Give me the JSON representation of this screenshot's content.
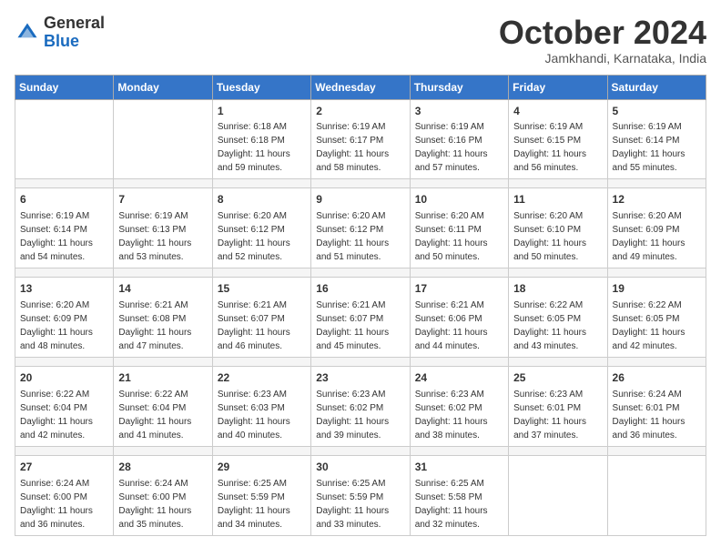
{
  "header": {
    "logo": {
      "general": "General",
      "blue": "Blue"
    },
    "month": "October 2024",
    "location": "Jamkhandi, Karnataka, India"
  },
  "weekdays": [
    "Sunday",
    "Monday",
    "Tuesday",
    "Wednesday",
    "Thursday",
    "Friday",
    "Saturday"
  ],
  "weeks": [
    [
      {
        "day": "",
        "sunrise": "",
        "sunset": "",
        "daylight": ""
      },
      {
        "day": "",
        "sunrise": "",
        "sunset": "",
        "daylight": ""
      },
      {
        "day": "1",
        "sunrise": "Sunrise: 6:18 AM",
        "sunset": "Sunset: 6:18 PM",
        "daylight": "Daylight: 11 hours and 59 minutes."
      },
      {
        "day": "2",
        "sunrise": "Sunrise: 6:19 AM",
        "sunset": "Sunset: 6:17 PM",
        "daylight": "Daylight: 11 hours and 58 minutes."
      },
      {
        "day": "3",
        "sunrise": "Sunrise: 6:19 AM",
        "sunset": "Sunset: 6:16 PM",
        "daylight": "Daylight: 11 hours and 57 minutes."
      },
      {
        "day": "4",
        "sunrise": "Sunrise: 6:19 AM",
        "sunset": "Sunset: 6:15 PM",
        "daylight": "Daylight: 11 hours and 56 minutes."
      },
      {
        "day": "5",
        "sunrise": "Sunrise: 6:19 AM",
        "sunset": "Sunset: 6:14 PM",
        "daylight": "Daylight: 11 hours and 55 minutes."
      }
    ],
    [
      {
        "day": "6",
        "sunrise": "Sunrise: 6:19 AM",
        "sunset": "Sunset: 6:14 PM",
        "daylight": "Daylight: 11 hours and 54 minutes."
      },
      {
        "day": "7",
        "sunrise": "Sunrise: 6:19 AM",
        "sunset": "Sunset: 6:13 PM",
        "daylight": "Daylight: 11 hours and 53 minutes."
      },
      {
        "day": "8",
        "sunrise": "Sunrise: 6:20 AM",
        "sunset": "Sunset: 6:12 PM",
        "daylight": "Daylight: 11 hours and 52 minutes."
      },
      {
        "day": "9",
        "sunrise": "Sunrise: 6:20 AM",
        "sunset": "Sunset: 6:12 PM",
        "daylight": "Daylight: 11 hours and 51 minutes."
      },
      {
        "day": "10",
        "sunrise": "Sunrise: 6:20 AM",
        "sunset": "Sunset: 6:11 PM",
        "daylight": "Daylight: 11 hours and 50 minutes."
      },
      {
        "day": "11",
        "sunrise": "Sunrise: 6:20 AM",
        "sunset": "Sunset: 6:10 PM",
        "daylight": "Daylight: 11 hours and 50 minutes."
      },
      {
        "day": "12",
        "sunrise": "Sunrise: 6:20 AM",
        "sunset": "Sunset: 6:09 PM",
        "daylight": "Daylight: 11 hours and 49 minutes."
      }
    ],
    [
      {
        "day": "13",
        "sunrise": "Sunrise: 6:20 AM",
        "sunset": "Sunset: 6:09 PM",
        "daylight": "Daylight: 11 hours and 48 minutes."
      },
      {
        "day": "14",
        "sunrise": "Sunrise: 6:21 AM",
        "sunset": "Sunset: 6:08 PM",
        "daylight": "Daylight: 11 hours and 47 minutes."
      },
      {
        "day": "15",
        "sunrise": "Sunrise: 6:21 AM",
        "sunset": "Sunset: 6:07 PM",
        "daylight": "Daylight: 11 hours and 46 minutes."
      },
      {
        "day": "16",
        "sunrise": "Sunrise: 6:21 AM",
        "sunset": "Sunset: 6:07 PM",
        "daylight": "Daylight: 11 hours and 45 minutes."
      },
      {
        "day": "17",
        "sunrise": "Sunrise: 6:21 AM",
        "sunset": "Sunset: 6:06 PM",
        "daylight": "Daylight: 11 hours and 44 minutes."
      },
      {
        "day": "18",
        "sunrise": "Sunrise: 6:22 AM",
        "sunset": "Sunset: 6:05 PM",
        "daylight": "Daylight: 11 hours and 43 minutes."
      },
      {
        "day": "19",
        "sunrise": "Sunrise: 6:22 AM",
        "sunset": "Sunset: 6:05 PM",
        "daylight": "Daylight: 11 hours and 42 minutes."
      }
    ],
    [
      {
        "day": "20",
        "sunrise": "Sunrise: 6:22 AM",
        "sunset": "Sunset: 6:04 PM",
        "daylight": "Daylight: 11 hours and 42 minutes."
      },
      {
        "day": "21",
        "sunrise": "Sunrise: 6:22 AM",
        "sunset": "Sunset: 6:04 PM",
        "daylight": "Daylight: 11 hours and 41 minutes."
      },
      {
        "day": "22",
        "sunrise": "Sunrise: 6:23 AM",
        "sunset": "Sunset: 6:03 PM",
        "daylight": "Daylight: 11 hours and 40 minutes."
      },
      {
        "day": "23",
        "sunrise": "Sunrise: 6:23 AM",
        "sunset": "Sunset: 6:02 PM",
        "daylight": "Daylight: 11 hours and 39 minutes."
      },
      {
        "day": "24",
        "sunrise": "Sunrise: 6:23 AM",
        "sunset": "Sunset: 6:02 PM",
        "daylight": "Daylight: 11 hours and 38 minutes."
      },
      {
        "day": "25",
        "sunrise": "Sunrise: 6:23 AM",
        "sunset": "Sunset: 6:01 PM",
        "daylight": "Daylight: 11 hours and 37 minutes."
      },
      {
        "day": "26",
        "sunrise": "Sunrise: 6:24 AM",
        "sunset": "Sunset: 6:01 PM",
        "daylight": "Daylight: 11 hours and 36 minutes."
      }
    ],
    [
      {
        "day": "27",
        "sunrise": "Sunrise: 6:24 AM",
        "sunset": "Sunset: 6:00 PM",
        "daylight": "Daylight: 11 hours and 36 minutes."
      },
      {
        "day": "28",
        "sunrise": "Sunrise: 6:24 AM",
        "sunset": "Sunset: 6:00 PM",
        "daylight": "Daylight: 11 hours and 35 minutes."
      },
      {
        "day": "29",
        "sunrise": "Sunrise: 6:25 AM",
        "sunset": "Sunset: 5:59 PM",
        "daylight": "Daylight: 11 hours and 34 minutes."
      },
      {
        "day": "30",
        "sunrise": "Sunrise: 6:25 AM",
        "sunset": "Sunset: 5:59 PM",
        "daylight": "Daylight: 11 hours and 33 minutes."
      },
      {
        "day": "31",
        "sunrise": "Sunrise: 6:25 AM",
        "sunset": "Sunset: 5:58 PM",
        "daylight": "Daylight: 11 hours and 32 minutes."
      },
      {
        "day": "",
        "sunrise": "",
        "sunset": "",
        "daylight": ""
      },
      {
        "day": "",
        "sunrise": "",
        "sunset": "",
        "daylight": ""
      }
    ]
  ]
}
